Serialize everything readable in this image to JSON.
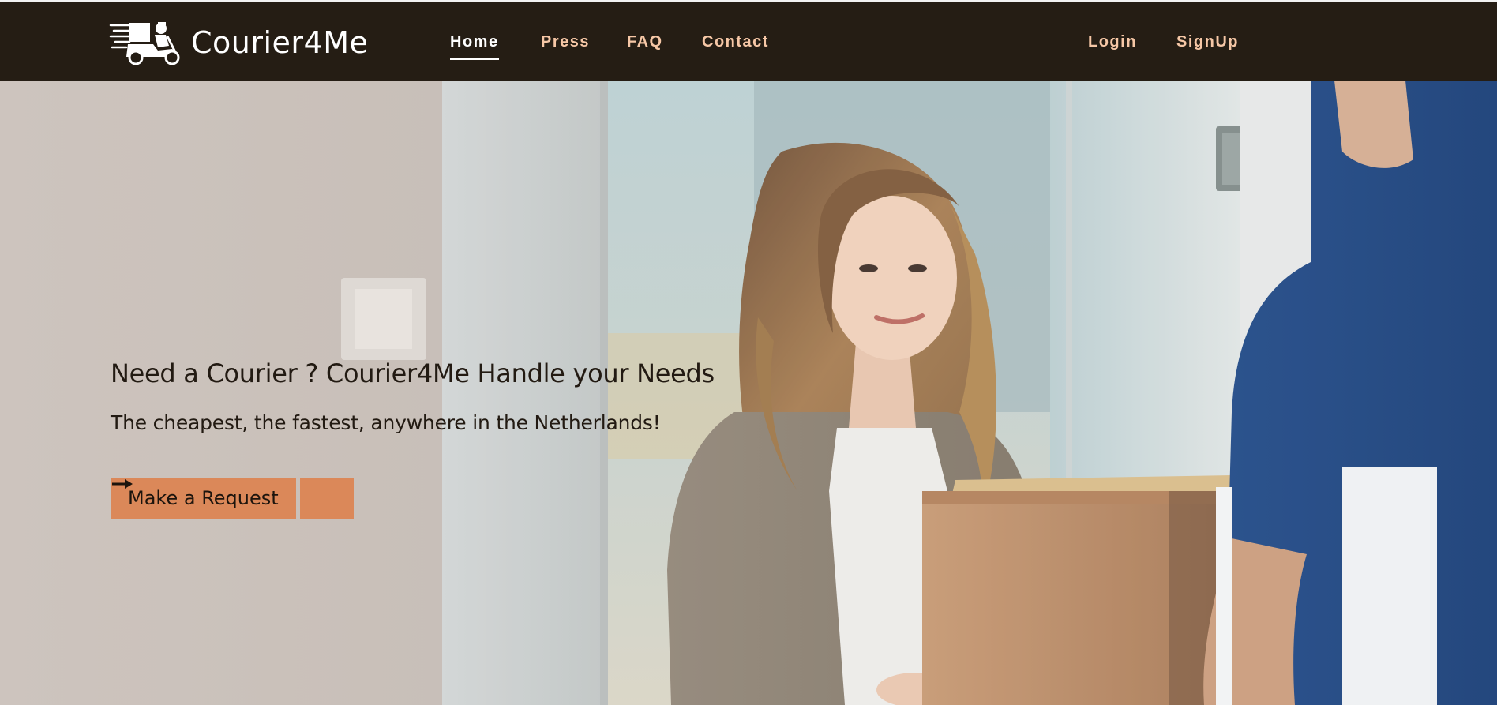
{
  "brand": {
    "name": "Courier4Me",
    "logo_icon": "delivery-scooter-icon"
  },
  "nav": {
    "left": [
      {
        "label": "Home",
        "active": true
      },
      {
        "label": "Press",
        "active": false
      },
      {
        "label": "FAQ",
        "active": false
      },
      {
        "label": "Contact",
        "active": false
      }
    ],
    "right": [
      {
        "label": "Login"
      },
      {
        "label": "SignUp"
      }
    ]
  },
  "hero": {
    "headline": "Need a Courier ? Courier4Me Handle your Needs",
    "subline": "The cheapest, the fastest, anywhere in the Netherlands!",
    "cta_label": "Make a Request",
    "cta_icon": "arrow-right-icon"
  },
  "colors": {
    "navbar_bg": "#251d14",
    "nav_link": "#f6c7a6",
    "nav_active": "#ffffff",
    "cta_bg": "#db8859",
    "text_dark": "#221a12"
  }
}
